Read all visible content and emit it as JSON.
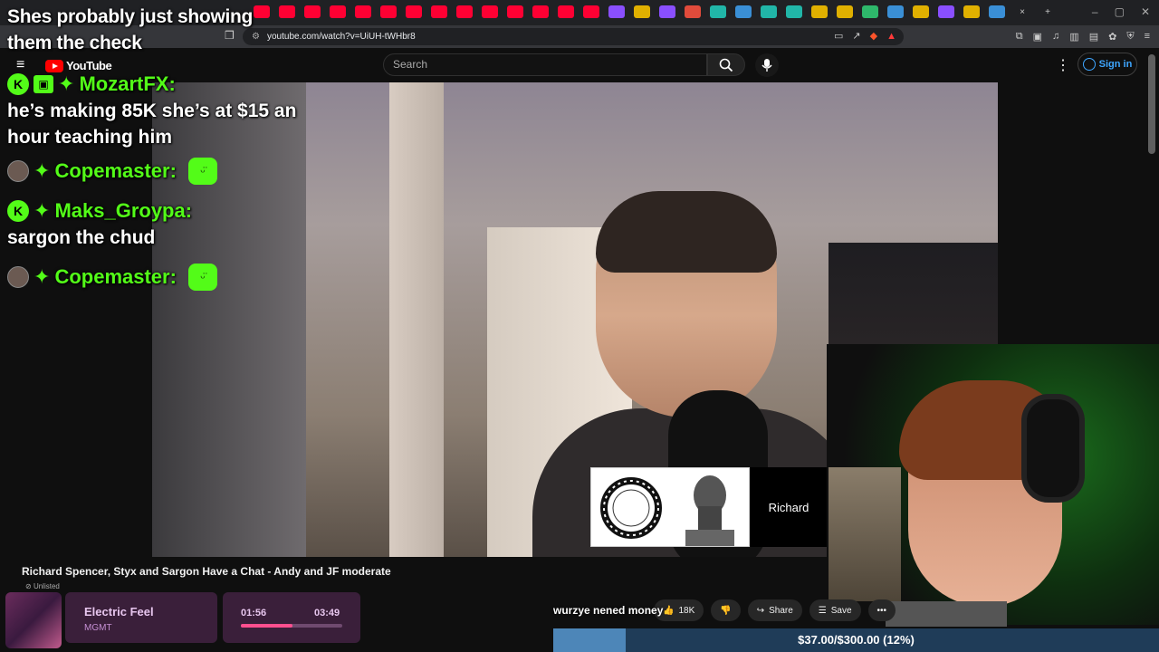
{
  "browser": {
    "url": "youtube.com/watch?v=UiUH-tWHbr8"
  },
  "youtube": {
    "logo_text": "YouTube",
    "search_placeholder": "Search",
    "sign_in_label": "Sign in"
  },
  "video": {
    "title": "Richard Spencer, Styx and Sargon Have a Chat - Andy and JF moderate",
    "visibility": "Unlisted",
    "name_tag": "Richard",
    "likes": "18K",
    "share_label": "Share",
    "save_label": "Save"
  },
  "chat": {
    "top_message": "Shes probably just showing them the check",
    "messages": [
      {
        "user": "MozartFX:",
        "text": "he’s making 85K she’s at $15 an hour teaching him"
      },
      {
        "user": "Copemaster:",
        "text": ""
      },
      {
        "user": "Maks_Groypa:",
        "text": "sargon the chud"
      },
      {
        "user": "Copemaster:",
        "text": ""
      }
    ]
  },
  "tts_message": "wurzye nened money",
  "now_playing": {
    "title": "Electric Feel",
    "artist": "MGMT",
    "elapsed": "01:56",
    "total": "03:49",
    "progress": 0.51
  },
  "donation_goal": {
    "text": "$37.00/$300.00 (12%)",
    "progress": 0.12
  }
}
